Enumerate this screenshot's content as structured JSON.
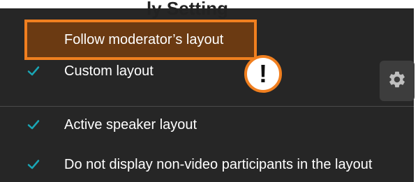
{
  "header": {
    "cut_text": "ly Setting"
  },
  "menu": {
    "highlighted_item": {
      "label": "Follow moderator’s layout"
    },
    "items": [
      {
        "label": "Custom layout",
        "checked": true
      },
      {
        "label": "Active speaker layout",
        "checked": true
      },
      {
        "label": "Do not display non-video participants in the layout",
        "checked": true
      }
    ]
  },
  "callout": {
    "symbol": "!"
  },
  "icons": {
    "check": "check-icon",
    "gear": "gear-icon"
  },
  "colors": {
    "menu_background": "#262626",
    "highlight_fill": "#6b3a12",
    "highlight_border": "#f07f1f",
    "check": "#19a6b5",
    "text": "#ffffff",
    "gear_button_background": "#3d3d3d",
    "gear_icon": "#bfbfbf"
  }
}
